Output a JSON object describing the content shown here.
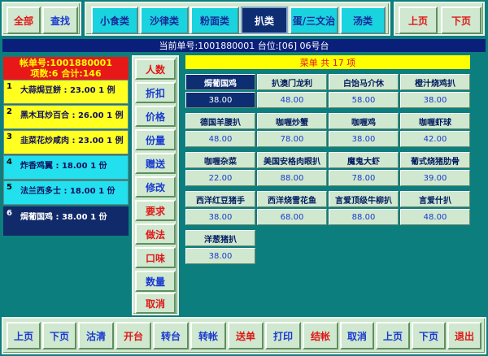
{
  "top_left": {
    "all_label": "全部",
    "find_label": "查找"
  },
  "categories": [
    {
      "label": "小食类"
    },
    {
      "label": "沙律类"
    },
    {
      "label": "粉面类"
    },
    {
      "label": "扒类"
    },
    {
      "label": "蛋/三文治"
    },
    {
      "label": "汤类"
    }
  ],
  "selected_category": "扒类",
  "top_right": {
    "prev_label": "上页",
    "next_label": "下页"
  },
  "status_text": "当前单号:1001880001  台位:[06]  06号台",
  "order": {
    "header_line1": "帐单号:1001880001",
    "header_line2": "项数:6 合计:146",
    "items": [
      {
        "num": "1",
        "text": "大蒜焗豆餅 : 23.00 1 例"
      },
      {
        "num": "2",
        "text": "黑木耳炒百合 : 26.00 1 例"
      },
      {
        "num": "3",
        "text": "韭菜花炒咸肉 : 23.00 1 例"
      },
      {
        "num": "4",
        "text": "炸香鸡翼 : 18.00 1 份"
      },
      {
        "num": "5",
        "text": "法兰西多士 : 18.00 1 份"
      },
      {
        "num": "6",
        "text": "焗葡国鸡 : 38.00 1 份"
      }
    ]
  },
  "side_buttons": {
    "b1": "人数",
    "b2": "折扣",
    "b3": "价格",
    "b4": "份量",
    "b5": "赠送",
    "b6": "修改",
    "b7": "要求",
    "b8": "做法",
    "b9": "口味",
    "b10": "数量",
    "b11": "取消"
  },
  "menu_header": "菜单 共 17 项",
  "dishes": [
    {
      "name": "焗葡国鸡",
      "price": "38.00"
    },
    {
      "name": "扒澳门龙利",
      "price": "48.00"
    },
    {
      "name": "白饴马介休",
      "price": "58.00"
    },
    {
      "name": "橙汁烧鸡扒",
      "price": "38.00"
    },
    {
      "name": "德国羊腰扒",
      "price": "48.00"
    },
    {
      "name": "咖喱炒蟹",
      "price": "78.00"
    },
    {
      "name": "咖喱鸡",
      "price": "38.00"
    },
    {
      "name": "咖喱虾球",
      "price": "42.00"
    },
    {
      "name": "咖喱杂菜",
      "price": "22.00"
    },
    {
      "name": "美国安格肉眼扒",
      "price": "88.00"
    },
    {
      "name": "魔鬼大虾",
      "price": "78.00"
    },
    {
      "name": "葡式烧猪肋骨",
      "price": "39.00"
    },
    {
      "name": "西洋红豆猪手",
      "price": "38.00"
    },
    {
      "name": "西洋烧雪花鱼",
      "price": "68.00"
    },
    {
      "name": "言爱顶级牛柳扒",
      "price": "88.00"
    },
    {
      "name": "言爱什扒",
      "price": "48.00"
    },
    {
      "name": "洋葱猪扒",
      "price": "38.00"
    }
  ],
  "bottom": {
    "prev1": "上页",
    "next1": "下页",
    "clear": "沽清",
    "open_table": "开台",
    "transfer_table": "转台",
    "transfer_account": "转帐",
    "send_order": "送单",
    "print": "打印",
    "checkout": "结帐",
    "cancel": "取消",
    "prev2": "上页",
    "next2": "下页",
    "exit": "退出"
  },
  "colors": {
    "background": "#0d7e7e",
    "panel": "#cfe8cf",
    "highlight": "#0e2e73",
    "accent_red": "#e01818",
    "cyan": "#19d3df",
    "yellow": "#ffff20"
  }
}
